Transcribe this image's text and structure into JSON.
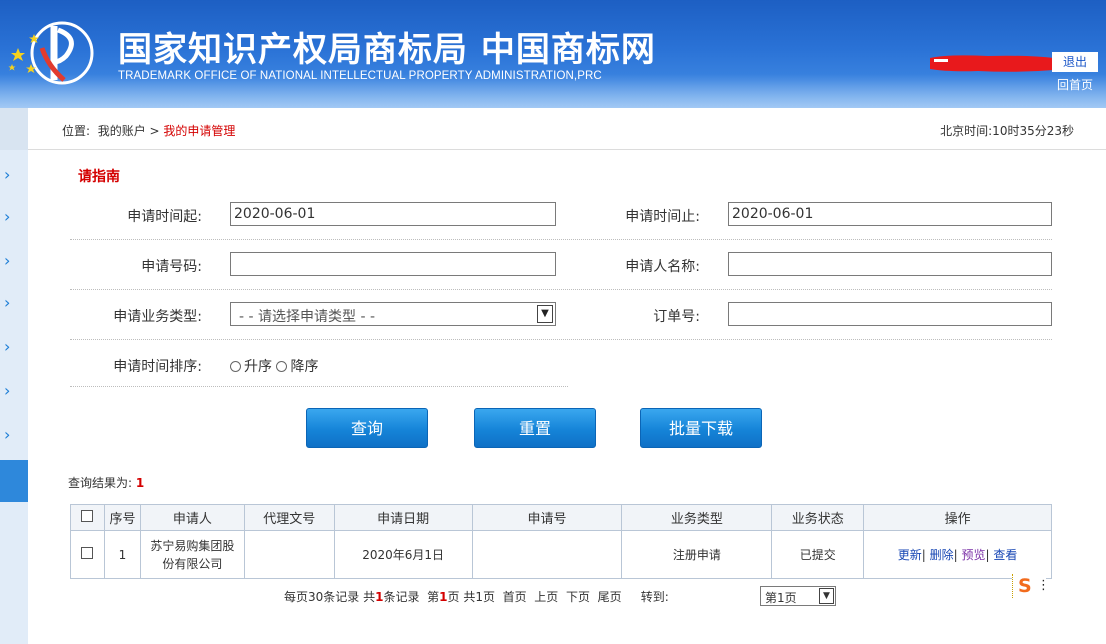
{
  "header": {
    "title_cn": "国家知识产权局商标局 中国商标网",
    "title_en": "TRADEMARK OFFICE OF NATIONAL INTELLECTUAL PROPERTY ADMINISTRATION,PRC",
    "logout_label": "退出",
    "home_label": "回首页",
    "colors": {
      "header_blue": "#1d5fc3",
      "redaction_red": "#e8191c"
    }
  },
  "breadcrumb": {
    "prefix": "位置:",
    "parent": "我的账户",
    "separator": ">",
    "current": "我的申请管理"
  },
  "clock": "北京时间:10时35分23秒",
  "guide_link": "请指南",
  "form": {
    "start_label": "申请时间起:",
    "start_value": "2020-06-01",
    "end_label": "申请时间止:",
    "end_value": "2020-06-01",
    "appno_label": "申请号码:",
    "appno_value": "",
    "applicant_label": "申请人名称:",
    "applicant_value": "",
    "type_label": "申请业务类型:",
    "type_selected": "- - 请选择申请类型 - -",
    "order_label": "订单号:",
    "order_value": "",
    "sort_label": "申请时间排序:",
    "sort_asc": "升序",
    "sort_desc": "降序"
  },
  "buttons": {
    "query": "查询",
    "reset": "重置",
    "batch_download": "批量下载"
  },
  "result": {
    "label": "查询结果为:",
    "count": "1"
  },
  "table": {
    "headers": [
      "序号",
      "申请人",
      "代理文号",
      "申请日期",
      "申请号",
      "业务类型",
      "业务状态",
      "操作"
    ],
    "rows": [
      {
        "no": "1",
        "applicant": "苏宁易购集团股份有限公司",
        "agent_no": "",
        "date": "2020年6月1日",
        "app_no": "",
        "biz_type": "注册申请",
        "status": "已提交",
        "ops": [
          "更新",
          "删除",
          "预览",
          "查看"
        ]
      }
    ]
  },
  "pager": {
    "per_page": "每页30条记录",
    "total_pre": "共",
    "total_num": "1",
    "total_post": "条记录",
    "page_pre": "第",
    "page_num": "1",
    "page_post": "页",
    "pages": "共1页",
    "first": "首页",
    "prev": "上页",
    "next": "下页",
    "last": "尾页",
    "goto_label": "转到:",
    "goto_selected": "第1页"
  },
  "sidebar": {
    "arrow_glyph": "›"
  },
  "sogou": {
    "glyph": "S",
    "menu": "⋮"
  }
}
